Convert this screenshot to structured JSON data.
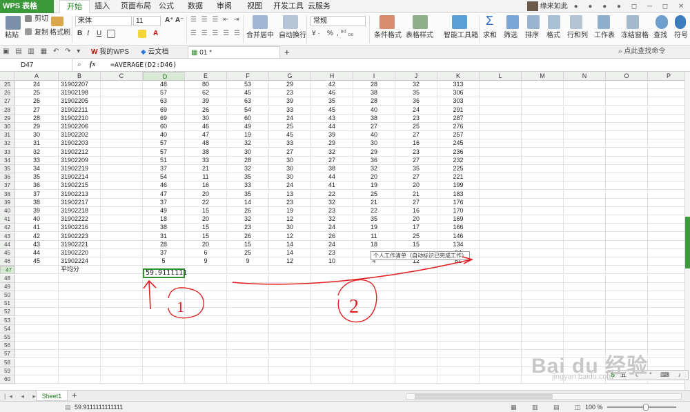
{
  "app": {
    "name": "WPS 表格",
    "tabs": [
      "开始",
      "插入",
      "页面布局",
      "公式",
      "数据",
      "审阅",
      "视图",
      "开发工具",
      "云服务"
    ],
    "active_tab": "开始",
    "user": "缘来如此"
  },
  "ribbon": {
    "paste": "粘贴",
    "cut": "剪切",
    "copy": "复制",
    "format_painter": "格式刷",
    "font": "宋体",
    "font_size": "11",
    "bold": "B",
    "italic": "I",
    "underline": "U",
    "merge_center": "合并居中",
    "wrap": "自动换行",
    "number_format": "常规",
    "percent": "%",
    "cond_format": "条件格式",
    "table_style": "表格样式",
    "smart_toolbox": "智能工具箱",
    "sum": "求和",
    "filter": "筛选",
    "sort": "排序",
    "format": "格式",
    "row_col": "行和列",
    "worksheet": "工作表",
    "freeze": "冻结窗格",
    "find": "查找",
    "symbol": "符号"
  },
  "doc_tabs": {
    "my_wps": "我的WPS",
    "cloud_doc": "云文档",
    "file": "01 *",
    "new": "+",
    "search": "点此查找命令"
  },
  "formula_bar": {
    "cell_ref": "D47",
    "fx": "fx",
    "formula": "=AVERAGE(D2:D46)"
  },
  "columns": [
    "A",
    "B",
    "C",
    "D",
    "E",
    "F",
    "G",
    "H",
    "I",
    "J",
    "K",
    "L",
    "M",
    "N",
    "O",
    "P"
  ],
  "rows": [
    {
      "n": "25",
      "c": [
        "24",
        "31902207",
        "",
        "48",
        "80",
        "53",
        "29",
        "42",
        "28",
        "32",
        "313"
      ]
    },
    {
      "n": "26",
      "c": [
        "25",
        "31902198",
        "",
        "57",
        "62",
        "45",
        "23",
        "46",
        "38",
        "35",
        "306"
      ]
    },
    {
      "n": "27",
      "c": [
        "26",
        "31902205",
        "",
        "63",
        "39",
        "63",
        "39",
        "35",
        "28",
        "36",
        "303"
      ]
    },
    {
      "n": "28",
      "c": [
        "27",
        "31902211",
        "",
        "69",
        "26",
        "54",
        "33",
        "45",
        "40",
        "24",
        "291"
      ]
    },
    {
      "n": "29",
      "c": [
        "28",
        "31902210",
        "",
        "69",
        "30",
        "60",
        "24",
        "43",
        "38",
        "23",
        "287"
      ]
    },
    {
      "n": "30",
      "c": [
        "29",
        "31902206",
        "",
        "60",
        "46",
        "49",
        "25",
        "44",
        "27",
        "25",
        "276"
      ]
    },
    {
      "n": "31",
      "c": [
        "30",
        "31902202",
        "",
        "40",
        "47",
        "19",
        "45",
        "39",
        "40",
        "27",
        "257"
      ]
    },
    {
      "n": "32",
      "c": [
        "31",
        "31902203",
        "",
        "57",
        "48",
        "32",
        "33",
        "29",
        "30",
        "16",
        "245"
      ]
    },
    {
      "n": "33",
      "c": [
        "32",
        "31902212",
        "",
        "57",
        "38",
        "30",
        "27",
        "32",
        "29",
        "23",
        "236"
      ]
    },
    {
      "n": "34",
      "c": [
        "33",
        "31902209",
        "",
        "51",
        "33",
        "28",
        "30",
        "27",
        "36",
        "27",
        "232"
      ]
    },
    {
      "n": "35",
      "c": [
        "34",
        "31902219",
        "",
        "37",
        "21",
        "32",
        "30",
        "38",
        "32",
        "35",
        "225"
      ]
    },
    {
      "n": "36",
      "c": [
        "35",
        "31902214",
        "",
        "54",
        "11",
        "35",
        "30",
        "44",
        "20",
        "27",
        "221"
      ]
    },
    {
      "n": "37",
      "c": [
        "36",
        "31902215",
        "",
        "46",
        "16",
        "33",
        "24",
        "41",
        "19",
        "20",
        "199"
      ]
    },
    {
      "n": "38",
      "c": [
        "37",
        "31902213",
        "",
        "47",
        "20",
        "35",
        "13",
        "22",
        "25",
        "21",
        "183"
      ]
    },
    {
      "n": "39",
      "c": [
        "38",
        "31902217",
        "",
        "37",
        "22",
        "14",
        "23",
        "32",
        "21",
        "27",
        "176"
      ]
    },
    {
      "n": "40",
      "c": [
        "39",
        "31902218",
        "",
        "49",
        "15",
        "26",
        "19",
        "23",
        "22",
        "16",
        "170"
      ]
    },
    {
      "n": "41",
      "c": [
        "40",
        "31902222",
        "",
        "18",
        "20",
        "32",
        "12",
        "32",
        "35",
        "20",
        "169"
      ]
    },
    {
      "n": "42",
      "c": [
        "41",
        "31902216",
        "",
        "38",
        "15",
        "23",
        "30",
        "24",
        "19",
        "17",
        "166"
      ]
    },
    {
      "n": "43",
      "c": [
        "42",
        "31902223",
        "",
        "31",
        "15",
        "26",
        "12",
        "26",
        "11",
        "25",
        "146"
      ]
    },
    {
      "n": "44",
      "c": [
        "43",
        "31902221",
        "",
        "28",
        "20",
        "15",
        "14",
        "24",
        "18",
        "15",
        "134"
      ]
    },
    {
      "n": "45",
      "c": [
        "44",
        "31902220",
        "",
        "37",
        "6",
        "25",
        "14",
        "23",
        "",
        "",
        "94"
      ]
    },
    {
      "n": "46",
      "c": [
        "45",
        "31902224",
        "",
        "5",
        "9",
        "9",
        "12",
        "10",
        "4",
        "12",
        "61"
      ]
    },
    {
      "n": "47",
      "c": [
        "",
        "平均分",
        "",
        "",
        "",
        "",
        "",
        "",
        "",
        "",
        ""
      ]
    },
    {
      "n": "48",
      "c": []
    },
    {
      "n": "49",
      "c": []
    },
    {
      "n": "50",
      "c": []
    },
    {
      "n": "51",
      "c": []
    },
    {
      "n": "52",
      "c": []
    },
    {
      "n": "53",
      "c": []
    },
    {
      "n": "54",
      "c": []
    },
    {
      "n": "55",
      "c": []
    },
    {
      "n": "56",
      "c": []
    },
    {
      "n": "57",
      "c": []
    },
    {
      "n": "58",
      "c": []
    },
    {
      "n": "59",
      "c": []
    },
    {
      "n": "60",
      "c": []
    }
  ],
  "active_cell_value": "59.9111111",
  "tooltip": "个人工作清单（自动标识已完成工作）",
  "annotations": {
    "mark1": "1",
    "mark2": "2"
  },
  "sheet": {
    "name": "Sheet1",
    "add": "+"
  },
  "status": {
    "value": "59.9111111111111",
    "zoom": "100 %"
  },
  "watermark": {
    "brand": "Bai du 经验",
    "url": "jingyan.baidu.com"
  },
  "colors": {
    "accent": "#2f8f2f",
    "annotation": "#e02020"
  }
}
